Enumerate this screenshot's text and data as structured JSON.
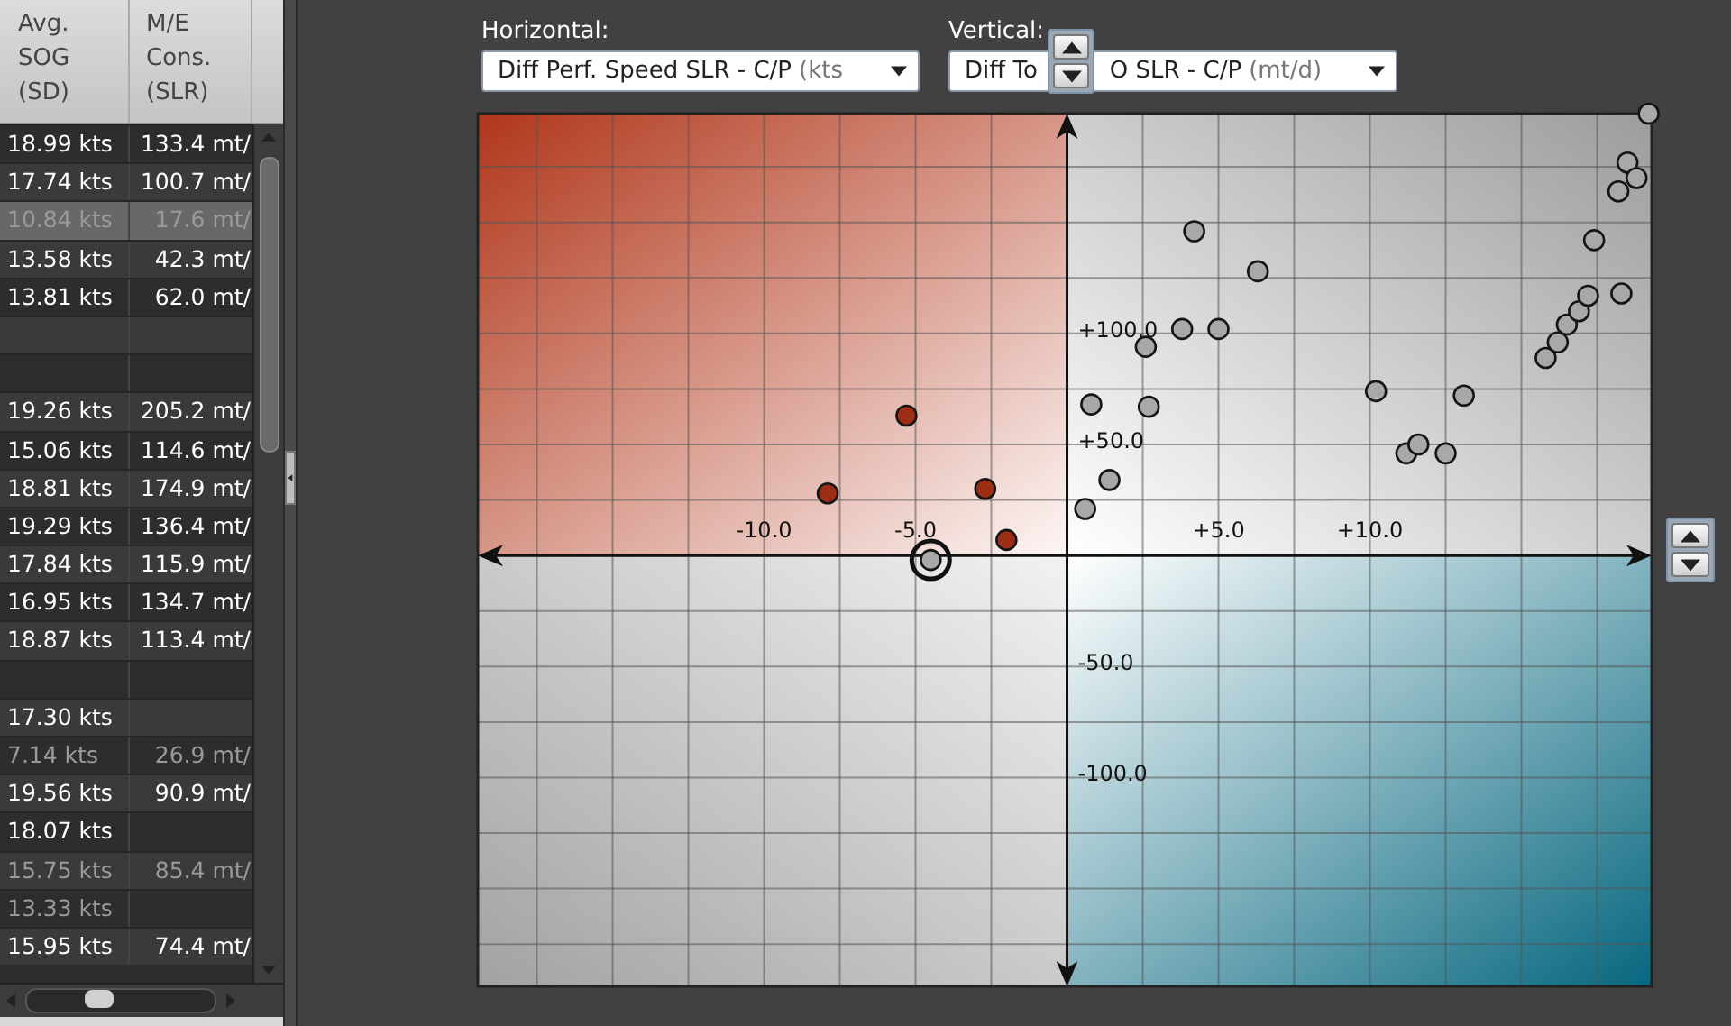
{
  "table": {
    "columns": [
      {
        "label": "Avg.\nSOG\n(SD)"
      },
      {
        "label": "M/E\nCons.\n(SLR)"
      }
    ],
    "rows": [
      {
        "sog": "18.99 kts",
        "cons": "133.4 mt/",
        "selected": false,
        "dimmed": false
      },
      {
        "sog": "17.74 kts",
        "cons": "100.7 mt/",
        "selected": false,
        "dimmed": false
      },
      {
        "sog": "10.84 kts",
        "cons": "17.6 mt/",
        "selected": true,
        "dimmed": true
      },
      {
        "sog": "13.58 kts",
        "cons": "42.3 mt/",
        "selected": false,
        "dimmed": false
      },
      {
        "sog": "13.81 kts",
        "cons": "62.0 mt/",
        "selected": false,
        "dimmed": false
      },
      {
        "selected": false
      },
      {
        "selected": false
      },
      {
        "sog": "19.26 kts",
        "cons": "205.2 mt/",
        "selected": false,
        "dimmed": false
      },
      {
        "sog": "15.06 kts",
        "cons": "114.6 mt/",
        "selected": false,
        "dimmed": false
      },
      {
        "sog": "18.81 kts",
        "cons": "174.9 mt/",
        "selected": false,
        "dimmed": false
      },
      {
        "sog": "19.29 kts",
        "cons": "136.4 mt/",
        "selected": false,
        "dimmed": false
      },
      {
        "sog": "17.84 kts",
        "cons": "115.9 mt/",
        "selected": false,
        "dimmed": false
      },
      {
        "sog": "16.95 kts",
        "cons": "134.7 mt/",
        "selected": false,
        "dimmed": false
      },
      {
        "sog": "18.87 kts",
        "cons": "113.4 mt/",
        "selected": false,
        "dimmed": false
      },
      {
        "selected": false
      },
      {
        "sog": "17.30 kts",
        "selected": false,
        "dimmed": false
      },
      {
        "sog": "7.14 kts",
        "cons": "26.9 mt/",
        "selected": false,
        "dimmed": true
      },
      {
        "sog": "19.56 kts",
        "cons": "90.9 mt/",
        "selected": false,
        "dimmed": false
      },
      {
        "sog": "18.07 kts",
        "selected": false,
        "dimmed": false
      },
      {
        "sog": "15.75 kts",
        "cons": "85.4 mt/",
        "selected": false,
        "dimmed": true
      },
      {
        "sog": "13.33 kts",
        "selected": false,
        "dimmed": true
      },
      {
        "sog": "15.95 kts",
        "cons": "74.4 mt/",
        "selected": false,
        "dimmed": false
      }
    ]
  },
  "controls": {
    "horizontal": {
      "label": "Horizontal:",
      "value_parts": [
        "Diff Perf. Speed SLR - C/P"
      ],
      "unit": "(kts"
    },
    "vertical": {
      "label": "Vertical:",
      "value_parts": [
        "Diff To",
        "O SLR - C/P"
      ],
      "unit": "(mt/d)"
    }
  },
  "chart": {
    "chart_data": {
      "type": "scatter",
      "xlim": [
        -19.45,
        19.3
      ],
      "ylim": [
        -194,
        199
      ],
      "xticks": [
        {
          "value": -10,
          "label": "-10.0"
        },
        {
          "value": -5,
          "label": "-5.0"
        },
        {
          "value": 5,
          "label": "+5.0"
        },
        {
          "value": 10,
          "label": "+10.0"
        }
      ],
      "yticks": [
        {
          "value": 100,
          "label": "+100.0"
        },
        {
          "value": 50,
          "label": "+50.0"
        },
        {
          "value": -50,
          "label": "-50.0"
        },
        {
          "value": -100,
          "label": "-100.0"
        }
      ],
      "series": [
        {
          "color": "#9c2e16",
          "x": [
            -5.3,
            -7.9,
            -2.7,
            -2.0
          ],
          "values": [
            63,
            28,
            30,
            7
          ]
        },
        {
          "color": "#a8a8a8",
          "x": [
            0.6,
            1.4,
            0.8,
            2.7,
            2.6,
            3.8,
            5.0,
            4.2,
            6.3,
            10.2,
            13.1,
            11.2,
            11.6,
            12.5,
            15.8,
            16.2,
            16.5,
            16.9,
            17.2,
            18.3,
            17.4,
            18.2,
            18.5,
            18.8,
            19.2
          ],
          "values": [
            21,
            34,
            68,
            67,
            94,
            102,
            102,
            146,
            128,
            74,
            72,
            46,
            50,
            46,
            89,
            96,
            104,
            110,
            117,
            118,
            142,
            164,
            177,
            170,
            199
          ]
        },
        {
          "color": "#a8a8a8",
          "x": [
            -4.5
          ],
          "values": [
            -2
          ]
        }
      ],
      "grid": true
    },
    "last_series_ringed": true
  }
}
